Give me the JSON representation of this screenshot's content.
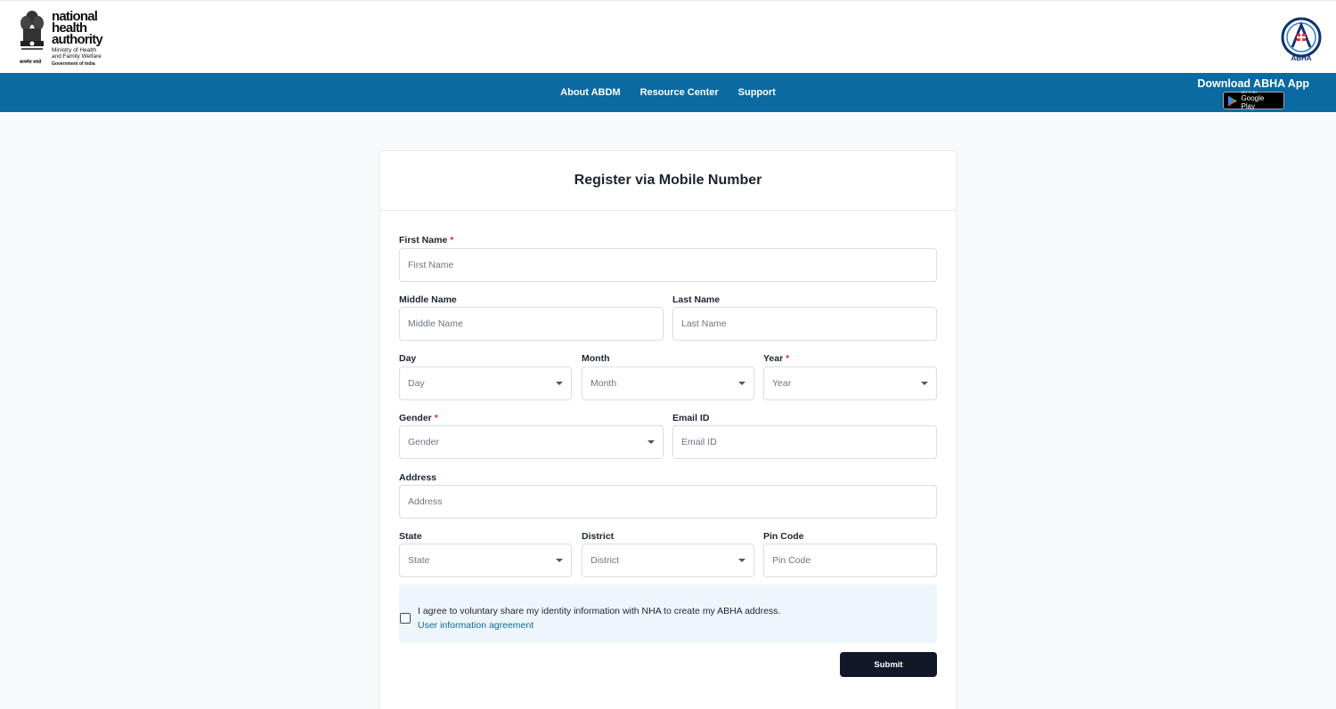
{
  "header": {
    "nha_title_lines": [
      "national",
      "health",
      "authority"
    ],
    "nha_ministry": "Ministry of Health and Family Welfare",
    "nha_government": "Government of India",
    "nha_motto": "सत्यमेव जयते",
    "abha_label": "ABHA"
  },
  "nav": {
    "links": [
      "About ABDM",
      "Resource Center",
      "Support"
    ],
    "download_text": "Download ABHA App",
    "gplay_small": "GET IT ON",
    "gplay_big": "Google Play"
  },
  "form": {
    "title": "Register via Mobile Number",
    "required_mark": "*",
    "first_name": {
      "label": "First Name",
      "placeholder": "First Name"
    },
    "middle_name": {
      "label": "Middle Name",
      "placeholder": "Middle Name"
    },
    "last_name": {
      "label": "Last Name",
      "placeholder": "Last Name"
    },
    "day": {
      "label": "Day",
      "value": "Day"
    },
    "month": {
      "label": "Month",
      "value": "Month"
    },
    "year": {
      "label": "Year",
      "value": "Year"
    },
    "gender": {
      "label": "Gender",
      "value": "Gender"
    },
    "email": {
      "label": "Email ID",
      "placeholder": "Email ID"
    },
    "address": {
      "label": "Address",
      "placeholder": "Address"
    },
    "state": {
      "label": "State",
      "value": "State"
    },
    "district": {
      "label": "District",
      "value": "District"
    },
    "pincode": {
      "label": "Pin Code",
      "placeholder": "Pin Code"
    },
    "consent_text": "I agree to voluntary share my identity information with NHA to create my ABHA address.",
    "consent_link": "User information agreement",
    "submit_label": "Submit"
  },
  "colors": {
    "nav_bg": "#0a6aa1",
    "submit_bg": "#111827",
    "required": "#d32f2f",
    "consent_bg": "#eef6fb"
  }
}
